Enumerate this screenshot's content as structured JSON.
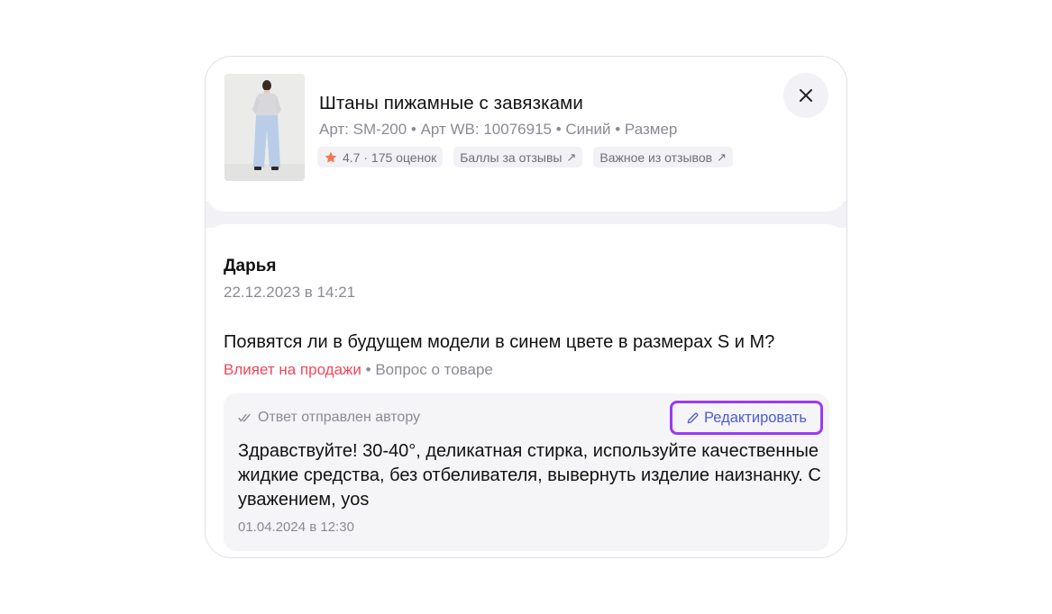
{
  "product": {
    "title": "Штаны пижамные с завязками",
    "meta": "Арт: SM-200 • Арт WB: 10076915 • Синий • Размер",
    "rating_text": "4.7 · 175 оценок",
    "chip_points": "Баллы за отзывы",
    "chip_important": "Важное из отзывов",
    "arrow": "↗"
  },
  "review": {
    "author": "Дарья",
    "date": "22.12.2023 в 14:21",
    "question": "Появятся ли в будущем модели в синем цвете в размерах  S и M?",
    "impact_tag": "Влияет на продажи",
    "tag_separator": " • ",
    "category_tag": "Вопрос о товаре"
  },
  "answer": {
    "status": "Ответ отправлен автору",
    "edit_label": "Редактировать",
    "text": "Здравствуйте! 30-40°, деликатная стирка, используйте качественные жидкие средства, без отбеливателя, вывернуть изделие наизнанку. С уважением, yos",
    "date": "01.04.2024 в 12:30"
  },
  "colors": {
    "accent_outline": "#9b39f5",
    "link": "#4e5ad9",
    "impact": "#f0485a",
    "star": "#f5784a"
  }
}
